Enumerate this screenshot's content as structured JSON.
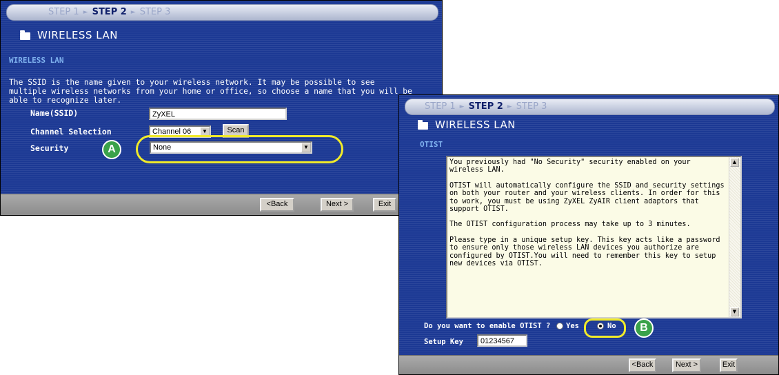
{
  "colors": {
    "panel_bg": "#1c3994",
    "section_heading": "#7fb2ef",
    "callout": "#f0ea2a",
    "badge": "#3aa24a"
  },
  "icons": {
    "folder": "folder-icon",
    "dropdown": "chevron-down-icon",
    "scroll_up": "scroll-up-icon",
    "scroll_down": "scroll-down-icon"
  },
  "panel_a": {
    "steps": [
      "STEP 1",
      "STEP 2",
      "STEP 3"
    ],
    "current_step": "STEP 2",
    "title": "WIRELESS LAN",
    "section": "WIRELESS LAN",
    "description": "The SSID is the name given to your wireless network. It may be possible to see multiple wireless networks from your home or office, so choose a name that you will be able to recognize later.",
    "ssid_label": "Name(SSID)",
    "ssid_value": "ZyXEL",
    "channel_label": "Channel Selection",
    "channel_value": "Channel 06",
    "scan_label": "Scan",
    "security_label": "Security",
    "security_value": "None",
    "back_label": "<Back",
    "next_label": "Next >",
    "exit_label": "Exit",
    "callout_letter": "A"
  },
  "panel_b": {
    "steps": [
      "STEP 1",
      "STEP 2",
      "STEP 3"
    ],
    "current_step": "STEP 2",
    "title": "WIRELESS LAN",
    "section": "OTIST",
    "paragraphs": [
      "You previously had \"No Security\" security enabled on your wireless LAN.",
      "OTIST will automatically configure the SSID and security settings on both your router and your wireless clients. In order for this to work, you must be using ZyXEL ZyAIR client adaptors that support OTIST.",
      "The OTIST configuration process may take up to 3 minutes.",
      "Please type in a unique setup key. This key acts like a password to ensure only those wireless LAN devices you authorize are configured by OTIST.You will need to remember this key to setup new devices via OTIST."
    ],
    "enable_question": "Do you want to enable OTIST ?",
    "yes_label": "Yes",
    "no_label": "No",
    "selected_option": "No",
    "setup_key_label": "Setup Key",
    "setup_key_value": "01234567",
    "back_label": "<Back",
    "next_label": "Next >",
    "exit_label": "Exit",
    "callout_letter": "B"
  }
}
